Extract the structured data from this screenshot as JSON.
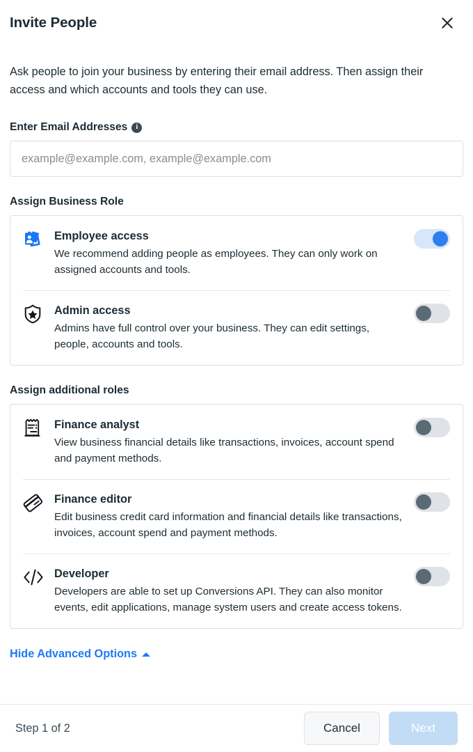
{
  "header": {
    "title": "Invite People",
    "close_icon": "close-icon"
  },
  "intro": "Ask people to join your business by entering their email address. Then assign their access and which accounts and tools they can use.",
  "email_field": {
    "label": "Enter Email Addresses",
    "info_icon": "info-icon",
    "info_glyph": "i",
    "placeholder": "example@example.com, example@example.com",
    "value": ""
  },
  "business_role": {
    "section_title": "Assign Business Role",
    "roles": [
      {
        "icon": "id-badge-icon",
        "name": "Employee access",
        "description": "We recommend adding people as employees. They can only work on assigned accounts and tools.",
        "enabled": true
      },
      {
        "icon": "shield-star-icon",
        "name": "Admin access",
        "description": "Admins have full control over your business. They can edit settings, people, accounts and tools.",
        "enabled": false
      }
    ]
  },
  "additional_roles": {
    "section_title": "Assign additional roles",
    "roles": [
      {
        "icon": "receipt-icon",
        "name": "Finance analyst",
        "description": "View business financial details like transactions, invoices, account spend and payment methods.",
        "enabled": false
      },
      {
        "icon": "credit-card-icon",
        "name": "Finance editor",
        "description": "Edit business credit card information and financial details like transactions, invoices, account spend and payment methods.",
        "enabled": false
      },
      {
        "icon": "code-brackets-icon",
        "name": "Developer",
        "description": "Developers are able to set up Conversions API. They can also monitor events, edit applications, manage system users and create access tokens.",
        "enabled": false
      }
    ]
  },
  "advanced_options": {
    "label": "Hide Advanced Options",
    "caret_icon": "caret-up-icon"
  },
  "footer": {
    "step_text": "Step 1 of 2",
    "cancel_label": "Cancel",
    "next_label": "Next"
  },
  "colors": {
    "accent_blue": "#1d7bf4",
    "toggle_on_track": "#d7e6fb",
    "toggle_on_knob": "#2d7ff0",
    "toggle_off_track": "#dfe3e7",
    "toggle_off_knob": "#5a6b76",
    "text_primary": "#1c2b33",
    "next_disabled": "#c3dcf5",
    "border": "#dddfe2"
  }
}
